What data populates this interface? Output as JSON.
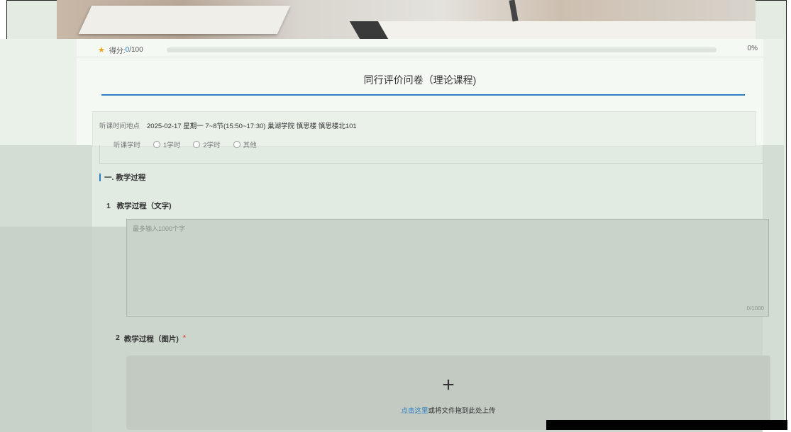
{
  "score": {
    "label": "得分: ",
    "value": "0",
    "max": "/100",
    "progress_fraction": 0,
    "percent": "0%"
  },
  "form": {
    "title": "同行评价问卷（理论课程)"
  },
  "info": {
    "time_place_label": "听课时间地点",
    "time_place_value": "2025-02-17 星期一 7~8节(15:50~17:30) 巢湖学院 慎思楼 慎思楼北101",
    "hours_label": "听课学时",
    "hours_options": [
      "1学时",
      "2学时",
      "其他"
    ]
  },
  "section1": {
    "heading": "一. 教学过程"
  },
  "question1": {
    "number": "1",
    "title": "教学过程（文字)",
    "placeholder": "最多输入1000个字",
    "counter": "0/1000"
  },
  "question2": {
    "number": "2",
    "title": "教学过程（图片)",
    "required_mark": "*",
    "upload_link": "点击这里",
    "upload_text": "或将文件拖到此处上传"
  },
  "colors": {
    "accent": "#2a7fc4",
    "star": "#f0a21a",
    "required": "#d9534f"
  }
}
